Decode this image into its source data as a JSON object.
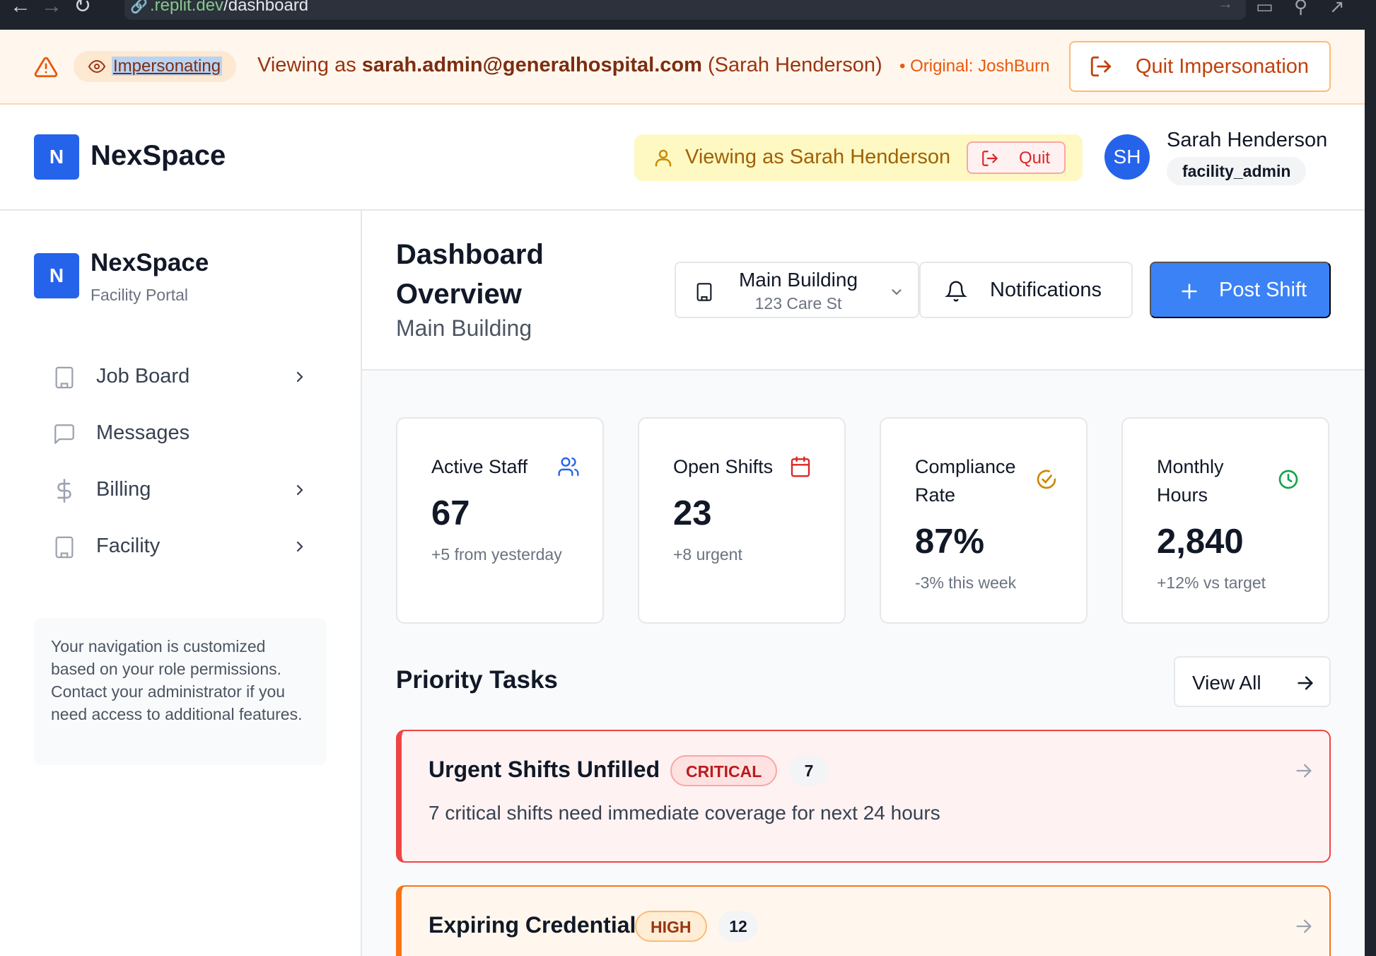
{
  "browser": {
    "url_host": ".replit.dev",
    "url_path": "/dashboard"
  },
  "impersonation_banner": {
    "badge": "Impersonating",
    "viewing_prefix": "Viewing as",
    "email": "sarah.admin@generalhospital.com",
    "name_paren": "(Sarah Henderson)",
    "original": "• Original: JoshBurn",
    "quit_label": "Quit Impersonation"
  },
  "header": {
    "logo_letter": "N",
    "brand": "NexSpace",
    "viewing_label": "Viewing as Sarah Henderson",
    "quit_label": "Quit",
    "avatar_initials": "SH",
    "user_name": "Sarah Henderson",
    "user_role": "facility_admin"
  },
  "sidebar": {
    "logo_letter": "N",
    "brand": "NexSpace",
    "subtitle": "Facility Portal",
    "items": [
      {
        "label": "Job Board",
        "icon": "building-icon",
        "has_chevron": true
      },
      {
        "label": "Messages",
        "icon": "message-icon",
        "has_chevron": false
      },
      {
        "label": "Billing",
        "icon": "dollar-icon",
        "has_chevron": true
      },
      {
        "label": "Facility",
        "icon": "building-icon",
        "has_chevron": true
      }
    ],
    "note": "Your navigation is customized based on your role permissions. Contact your administrator if you need access to additional features."
  },
  "main": {
    "title": "Dashboard Overview",
    "subtitle": "Main Building",
    "building_select": {
      "name": "Main Building",
      "address": "123 Care St"
    },
    "notifications_label": "Notifications",
    "post_shift_label": "Post Shift"
  },
  "stats": [
    {
      "label": "Active Staff",
      "value": "67",
      "change": "+5 from yesterday",
      "icon": "users-icon",
      "color": "#2563eb"
    },
    {
      "label": "Open Shifts",
      "value": "23",
      "change": "+8 urgent",
      "icon": "calendar-icon",
      "color": "#dc2626"
    },
    {
      "label": "Compliance Rate",
      "value": "87%",
      "change": "-3% this week",
      "icon": "check-circle-icon",
      "color": "#ca8a04"
    },
    {
      "label": "Monthly Hours",
      "value": "2,840",
      "change": "+12% vs target",
      "icon": "clock-icon",
      "color": "#16a34a"
    }
  ],
  "priority_tasks": {
    "title": "Priority Tasks",
    "view_all_label": "View All",
    "items": [
      {
        "title": "Urgent Shifts Unfilled",
        "badge": "CRITICAL",
        "count": "7",
        "description": "7 critical shifts need immediate coverage for next 24 hours",
        "accent": "#ef4444"
      },
      {
        "title": "Expiring Credentials",
        "badge": "HIGH",
        "count": "12",
        "description": "",
        "accent": "#f97316"
      }
    ]
  }
}
